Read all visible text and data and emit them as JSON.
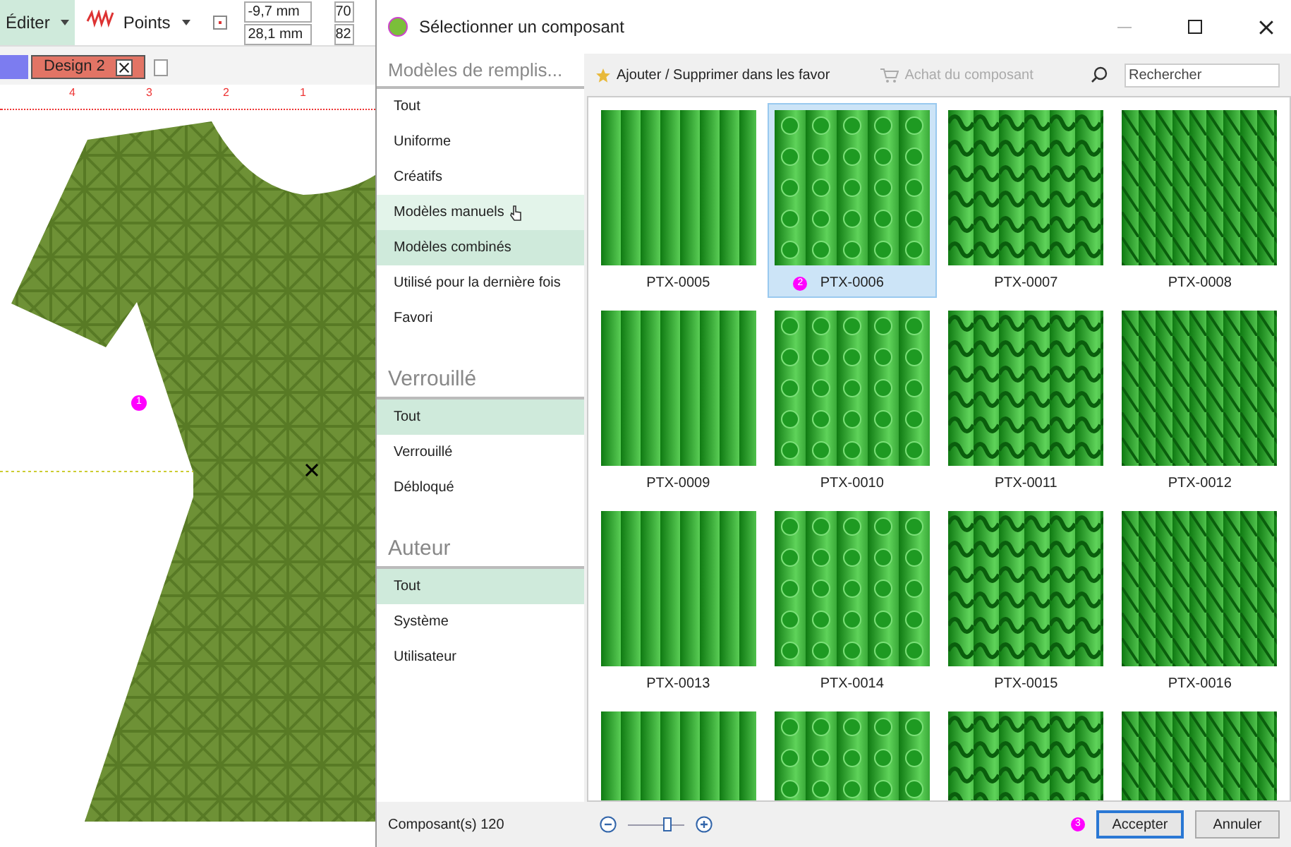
{
  "app": {
    "toolbar": {
      "edit_menu": "Éditer",
      "points_menu": "Points",
      "x_value": "-9,7 mm",
      "y_value": "28,1 mm",
      "width_value": "70",
      "height_value": "82"
    },
    "tabs": [
      {
        "selected": false
      },
      {
        "label": "Design 2",
        "selected": true
      }
    ],
    "ruler_labels": [
      "4",
      "3",
      "2",
      "1"
    ],
    "canvas_badge": "1"
  },
  "dialog": {
    "title": "Sélectionner un composant",
    "toolbar": {
      "favorites_button": "Ajouter / Supprimer dans les favor",
      "purchase_button": "Achat du composant",
      "search_placeholder": "Rechercher"
    },
    "sidebar": [
      {
        "heading": "Modèles de remplis...",
        "items": [
          {
            "label": "Tout",
            "selected": false,
            "hovered": false
          },
          {
            "label": "Uniforme",
            "selected": false,
            "hovered": false
          },
          {
            "label": "Créatifs",
            "selected": false,
            "hovered": false
          },
          {
            "label": "Modèles manuels",
            "selected": false,
            "hovered": true
          },
          {
            "label": "Modèles combinés",
            "selected": true,
            "hovered": false
          },
          {
            "label": "Utilisé pour la dernière fois",
            "selected": false,
            "hovered": false
          },
          {
            "label": "Favori",
            "selected": false,
            "hovered": false
          }
        ]
      },
      {
        "heading": "Verrouillé",
        "items": [
          {
            "label": "Tout",
            "selected": true,
            "hovered": false
          },
          {
            "label": "Verrouillé",
            "selected": false,
            "hovered": false
          },
          {
            "label": "Débloqué",
            "selected": false,
            "hovered": false
          }
        ]
      },
      {
        "heading": "Auteur",
        "items": [
          {
            "label": "Tout",
            "selected": true,
            "hovered": false
          },
          {
            "label": "Système",
            "selected": false,
            "hovered": false
          },
          {
            "label": "Utilisateur",
            "selected": false,
            "hovered": false
          }
        ]
      }
    ],
    "tiles": [
      {
        "label": "PTX-0005",
        "selected": false
      },
      {
        "label": "PTX-0006",
        "selected": true,
        "badge": "2"
      },
      {
        "label": "PTX-0007",
        "selected": false
      },
      {
        "label": "PTX-0008",
        "selected": false
      },
      {
        "label": "PTX-0009",
        "selected": false
      },
      {
        "label": "PTX-0010",
        "selected": false
      },
      {
        "label": "PTX-0011",
        "selected": false
      },
      {
        "label": "PTX-0012",
        "selected": false
      },
      {
        "label": "PTX-0013",
        "selected": false
      },
      {
        "label": "PTX-0014",
        "selected": false
      },
      {
        "label": "PTX-0015",
        "selected": false
      },
      {
        "label": "PTX-0016",
        "selected": false
      },
      {
        "selected": false
      },
      {
        "selected": false
      },
      {
        "selected": false
      },
      {
        "selected": false
      }
    ],
    "footer": {
      "count": "Composant(s) 120",
      "zoom": {
        "level": 0.7
      },
      "badge": "3",
      "accept_button": "Accepter",
      "cancel_button": "Annuler"
    }
  }
}
